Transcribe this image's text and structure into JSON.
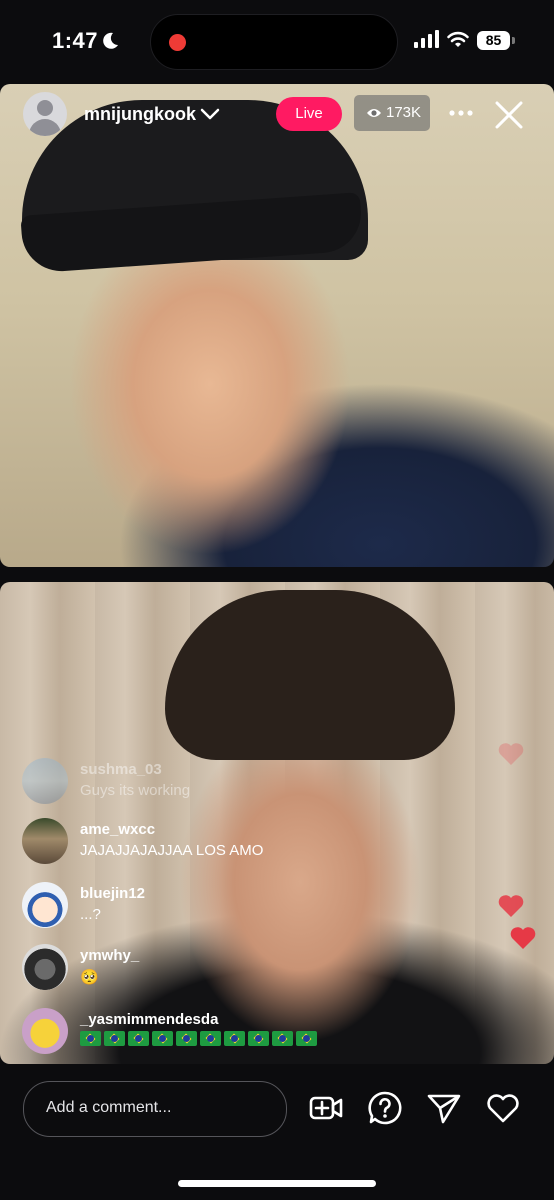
{
  "status_bar": {
    "time": "1:47",
    "battery": "85"
  },
  "header": {
    "username": "mnijungkook",
    "live_label": "Live",
    "viewer_count": "173K"
  },
  "comments": [
    {
      "user": "sushma_03",
      "text": "Guys its working",
      "faded": true
    },
    {
      "user": "ame_wxcc",
      "text": "JAJAJJAJAJJAA LOS AMO"
    },
    {
      "user": "bluejin12",
      "text": "...?"
    },
    {
      "user": "ymwhy_",
      "text": "🥺"
    },
    {
      "user": "_yasmimmendesda",
      "text": "🇧🇷🇧🇷🇧🇷🇧🇷🇧🇷🇧🇷🇧🇷🇧🇷🇧🇷🇧🇷"
    }
  ],
  "composer": {
    "placeholder": "Add a comment..."
  },
  "colors": {
    "live": "#ff1a62",
    "heart": "#e63946",
    "background": "#0c0c0e"
  },
  "icons": [
    "moon-icon",
    "signal-icon",
    "wifi-icon",
    "chevron-down-icon",
    "eye-icon",
    "more-icon",
    "close-icon",
    "add-video-icon",
    "question-icon",
    "send-icon",
    "heart-icon"
  ]
}
